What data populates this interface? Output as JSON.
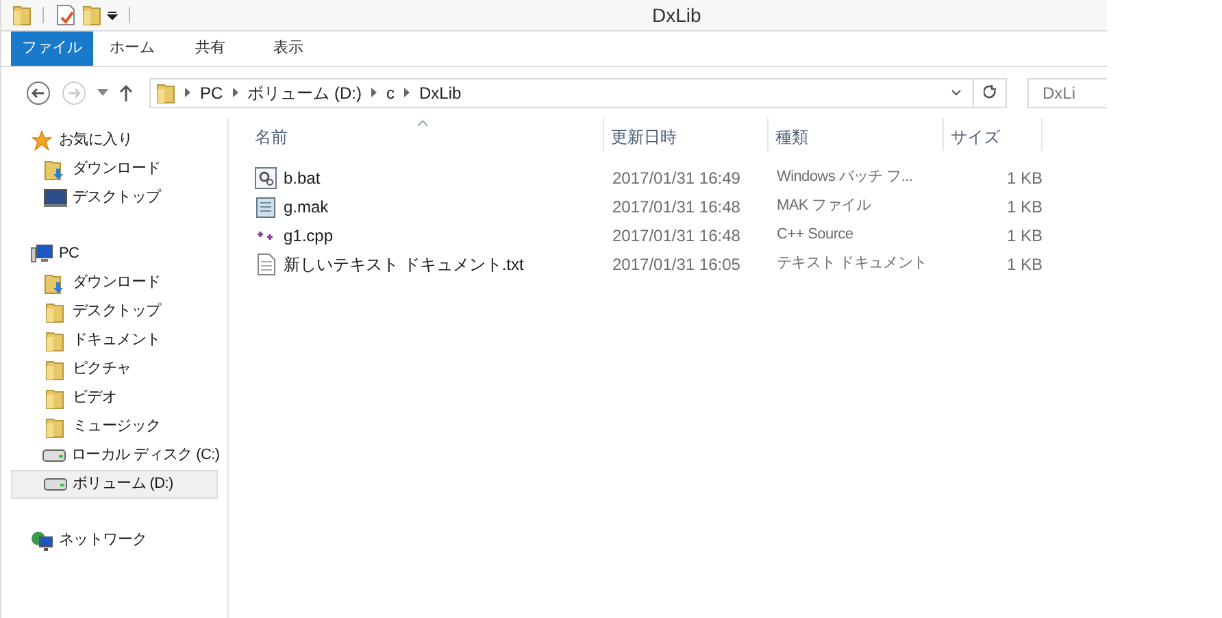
{
  "window": {
    "title": "DxLib"
  },
  "ribbon_tabs": [
    {
      "label": "ファイル",
      "selected": true
    },
    {
      "label": "ホーム",
      "selected": false
    },
    {
      "label": "共有",
      "selected": false
    },
    {
      "label": "表示",
      "selected": false
    }
  ],
  "address_bar": {
    "segments": [
      "PC",
      "ボリューム (D:)",
      "c",
      "DxLib"
    ]
  },
  "search": {
    "placeholder": "DxLi"
  },
  "sidebar": {
    "groups": [
      {
        "label": "お気に入り",
        "kind": "star",
        "selected": false,
        "children": [
          {
            "label": "ダウンロード",
            "kind": "downloads",
            "selected": false
          },
          {
            "label": "デスクトップ",
            "kind": "desktop",
            "selected": false
          }
        ]
      },
      {
        "label": "PC",
        "kind": "pc",
        "selected": false,
        "children": [
          {
            "label": "ダウンロード",
            "kind": "downloads",
            "selected": false
          },
          {
            "label": "デスクトップ",
            "kind": "folder",
            "selected": false
          },
          {
            "label": "ドキュメント",
            "kind": "folder",
            "selected": false
          },
          {
            "label": "ピクチャ",
            "kind": "folder",
            "selected": false
          },
          {
            "label": "ビデオ",
            "kind": "folder",
            "selected": false
          },
          {
            "label": "ミュージック",
            "kind": "folder",
            "selected": false
          },
          {
            "label": "ローカル ディスク (C:)",
            "kind": "drive",
            "selected": false
          },
          {
            "label": "ボリューム (D:)",
            "kind": "drive",
            "selected": true
          }
        ]
      },
      {
        "label": "ネットワーク",
        "kind": "network",
        "selected": false
      }
    ]
  },
  "table": {
    "columns": [
      "名前",
      "更新日時",
      "種類",
      "サイズ"
    ],
    "rows": [
      {
        "kind": "bat",
        "name": "b.bat",
        "date": "2017/01/31 16:49",
        "type": "Windows バッチ フ...",
        "size": "1 KB"
      },
      {
        "kind": "mak",
        "name": "g.mak",
        "date": "2017/01/31 16:48",
        "type": "MAK ファイル",
        "size": "1 KB"
      },
      {
        "kind": "cpp",
        "name": "g1.cpp",
        "date": "2017/01/31 16:48",
        "type": "C++ Source",
        "size": "1 KB"
      },
      {
        "kind": "txt",
        "name": "新しいテキスト ドキュメント.txt",
        "date": "2017/01/31 16:05",
        "type": "テキスト ドキュメント",
        "size": "1 KB"
      }
    ]
  }
}
